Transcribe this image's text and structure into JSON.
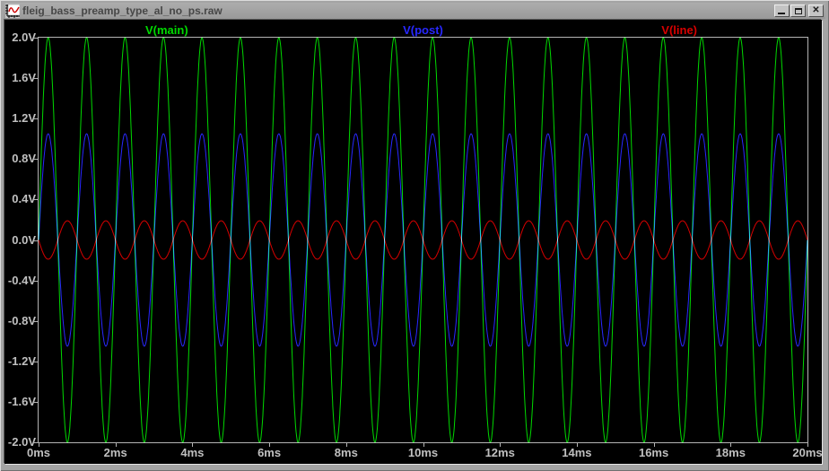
{
  "window": {
    "title": "fleig_bass_preamp_type_al_no_ps.raw",
    "icon": "waveform-app-icon",
    "controls": [
      {
        "name": "minimize"
      },
      {
        "name": "maximize"
      },
      {
        "name": "close"
      }
    ]
  },
  "chart_data": {
    "type": "line",
    "title": "",
    "xlabel": "",
    "ylabel": "",
    "grid": false,
    "legend_position": "top",
    "plot_background": "#000000",
    "axis_text_color": "#c0c0c0",
    "border_color": "#b4b4b4",
    "x": {
      "unit": "ms",
      "min_ms": 0,
      "max_ms": 20,
      "tick_step_ms": 2,
      "tick_labels": [
        "0ms",
        "2ms",
        "4ms",
        "6ms",
        "8ms",
        "10ms",
        "12ms",
        "14ms",
        "16ms",
        "18ms",
        "20ms"
      ]
    },
    "y": {
      "unit": "V",
      "min_V": -2.0,
      "max_V": 2.0,
      "tick_step_V": 0.4,
      "tick_labels": [
        "2.0V",
        "1.6V",
        "1.2V",
        "0.8V",
        "0.4V",
        "0.0V",
        "-0.4V",
        "-0.8V",
        "-1.2V",
        "-1.6V",
        "-2.0V"
      ]
    },
    "series": [
      {
        "name": "V(main)",
        "color": "#00d800",
        "waveform": "sine",
        "amplitude_V": 2.0,
        "frequency_hz": 1000,
        "phase_deg": 0,
        "offset_V": 0
      },
      {
        "name": "V(post)",
        "color": "#2828ff",
        "waveform": "sine",
        "amplitude_V": 1.05,
        "frequency_hz": 1000,
        "phase_deg": 0,
        "offset_V": 0
      },
      {
        "name": "V(line)",
        "color": "#d80000",
        "waveform": "sine",
        "amplitude_V": 0.19,
        "frequency_hz": 1000,
        "phase_deg": 180,
        "offset_V": 0
      }
    ]
  }
}
